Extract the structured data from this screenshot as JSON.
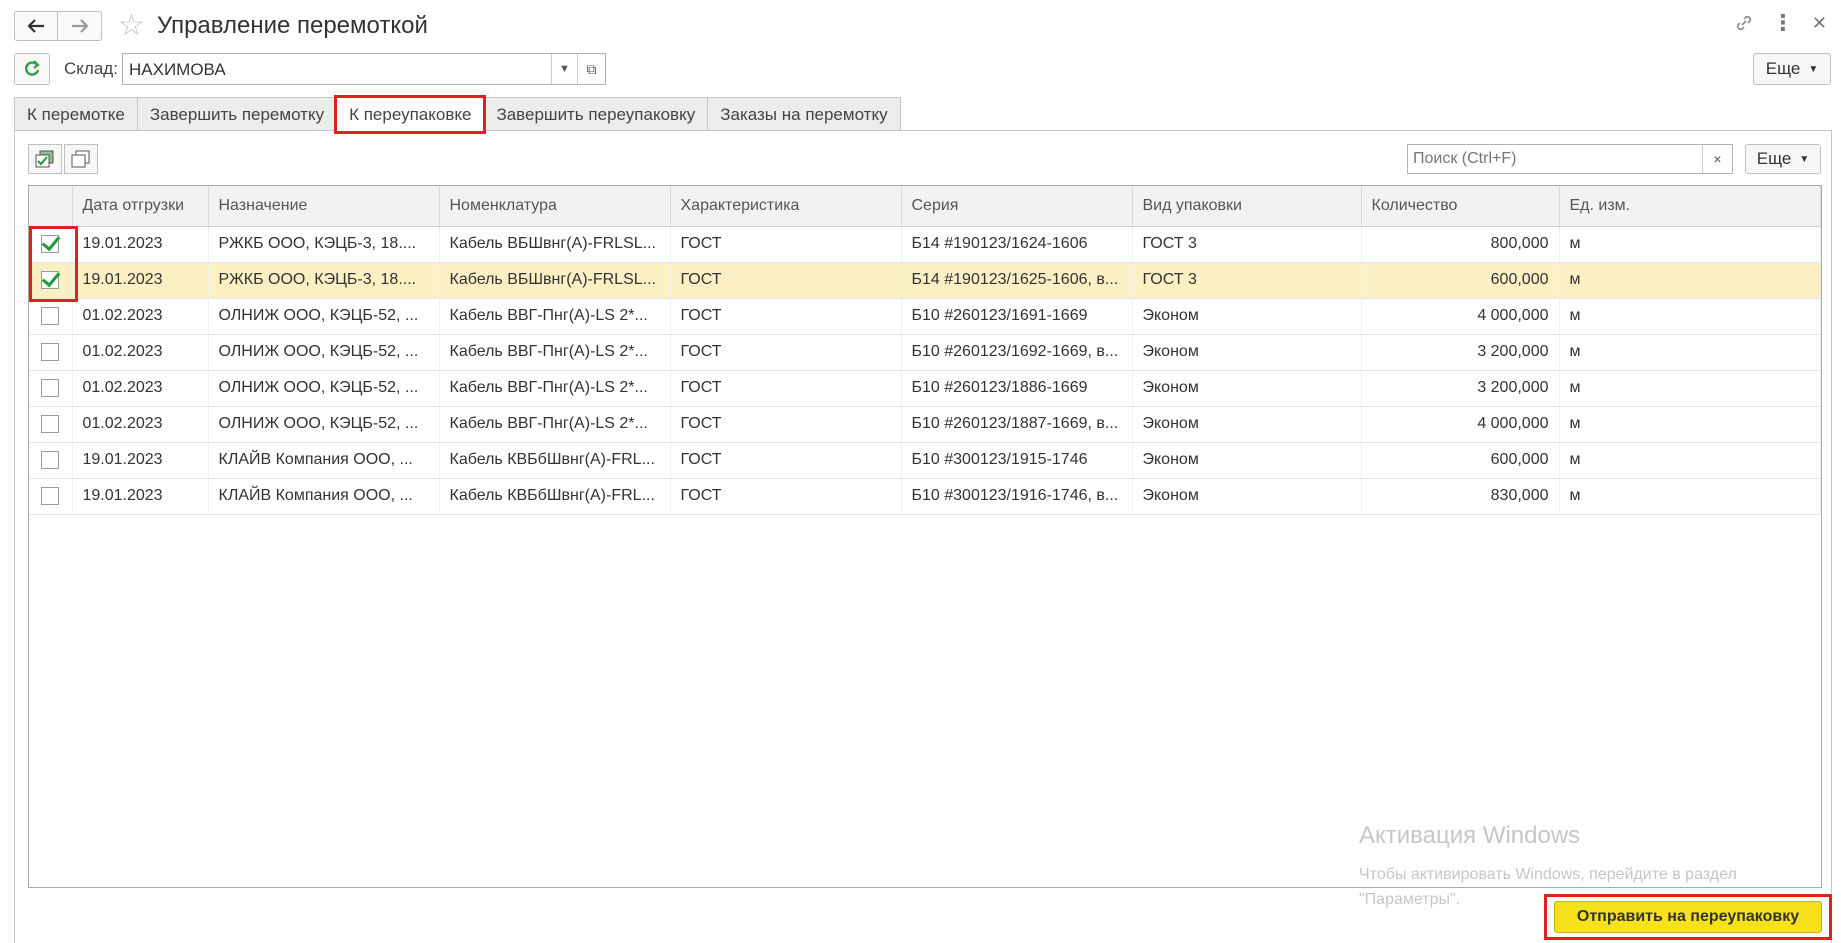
{
  "window": {
    "title": "Управление перемоткой",
    "icons": [
      "arrow-left-icon",
      "arrow-right-icon",
      "star-icon",
      "link-icon",
      "more-vertical-icon",
      "close-icon"
    ]
  },
  "filter": {
    "warehouse_label": "Склад:",
    "warehouse_value": "НАХИМОВА",
    "more_label": "Еще"
  },
  "tabs": [
    {
      "label": "К перемотке"
    },
    {
      "label": "Завершить перемотку"
    },
    {
      "label": "К переупаковке",
      "active": true
    },
    {
      "label": "Завершить переупаковку"
    },
    {
      "label": "Заказы на перемотку"
    }
  ],
  "toolbar": {
    "search_placeholder": "Поиск (Ctrl+F)",
    "clear_label": "×",
    "more_label": "Еще"
  },
  "table": {
    "columns": [
      "Дата отгрузки",
      "Назначение",
      "Номенклатура",
      "Характеристика",
      "Серия",
      "Вид упаковки",
      "Количество",
      "Ед. изм."
    ],
    "rows": [
      {
        "checked": true,
        "date": "19.01.2023",
        "purpose": "РЖКБ ООО, КЭЦБ-3, 18....",
        "item": "Кабель ВБШвнг(А)-FRLSL...",
        "char": "ГОСТ",
        "series": "Б14 #190123/1624-1606",
        "pack": "ГОСТ 3",
        "qty": "800,000",
        "unit": "м"
      },
      {
        "checked": true,
        "date": "19.01.2023",
        "purpose": "РЖКБ ООО, КЭЦБ-3, 18....",
        "item": "Кабель ВБШвнг(А)-FRLSL...",
        "char": "ГОСТ",
        "series": "Б14 #190123/1625-1606, в...",
        "pack": "ГОСТ 3",
        "qty": "600,000",
        "unit": "м"
      },
      {
        "checked": false,
        "date": "01.02.2023",
        "purpose": "ОЛНИЖ ООО, КЭЦБ-52, ...",
        "item": "Кабель ВВГ-Пнг(А)-LS 2*...",
        "char": "ГОСТ",
        "series": "Б10 #260123/1691-1669",
        "pack": "Эконом",
        "qty": "4 000,000",
        "unit": "м"
      },
      {
        "checked": false,
        "date": "01.02.2023",
        "purpose": "ОЛНИЖ ООО, КЭЦБ-52, ...",
        "item": "Кабель ВВГ-Пнг(А)-LS 2*...",
        "char": "ГОСТ",
        "series": "Б10 #260123/1692-1669, в...",
        "pack": "Эконом",
        "qty": "3 200,000",
        "unit": "м"
      },
      {
        "checked": false,
        "date": "01.02.2023",
        "purpose": "ОЛНИЖ ООО, КЭЦБ-52, ...",
        "item": "Кабель ВВГ-Пнг(А)-LS 2*...",
        "char": "ГОСТ",
        "series": "Б10 #260123/1886-1669",
        "pack": "Эконом",
        "qty": "3 200,000",
        "unit": "м"
      },
      {
        "checked": false,
        "date": "01.02.2023",
        "purpose": "ОЛНИЖ ООО, КЭЦБ-52, ...",
        "item": "Кабель ВВГ-Пнг(А)-LS 2*...",
        "char": "ГОСТ",
        "series": "Б10 #260123/1887-1669, в...",
        "pack": "Эконом",
        "qty": "4 000,000",
        "unit": "м"
      },
      {
        "checked": false,
        "date": "19.01.2023",
        "purpose": "КЛАЙВ Компания ООО, ...",
        "item": "Кабель КВБбШвнг(А)-FRL...",
        "char": "ГОСТ",
        "series": "Б10 #300123/1915-1746",
        "pack": "Эконом",
        "qty": "600,000",
        "unit": "м"
      },
      {
        "checked": false,
        "date": "19.01.2023",
        "purpose": "КЛАЙВ Компания ООО, ...",
        "item": "Кабель КВБбШвнг(А)-FRL...",
        "char": "ГОСТ",
        "series": "Б10 #300123/1916-1746, в...",
        "pack": "Эконом",
        "qty": "830,000",
        "unit": "м"
      }
    ]
  },
  "watermark": {
    "title": "Активация Windows",
    "line1": "Чтобы активировать Windows, перейдите в раздел",
    "line2": "\"Параметры\"."
  },
  "actions": {
    "send_label": "Отправить на переупаковку"
  },
  "colors": {
    "accent_yellow": "#f7e11a",
    "highlight_red": "#e0201c",
    "selected_row": "#fbf0c4",
    "check_green": "#1e9a3c"
  }
}
